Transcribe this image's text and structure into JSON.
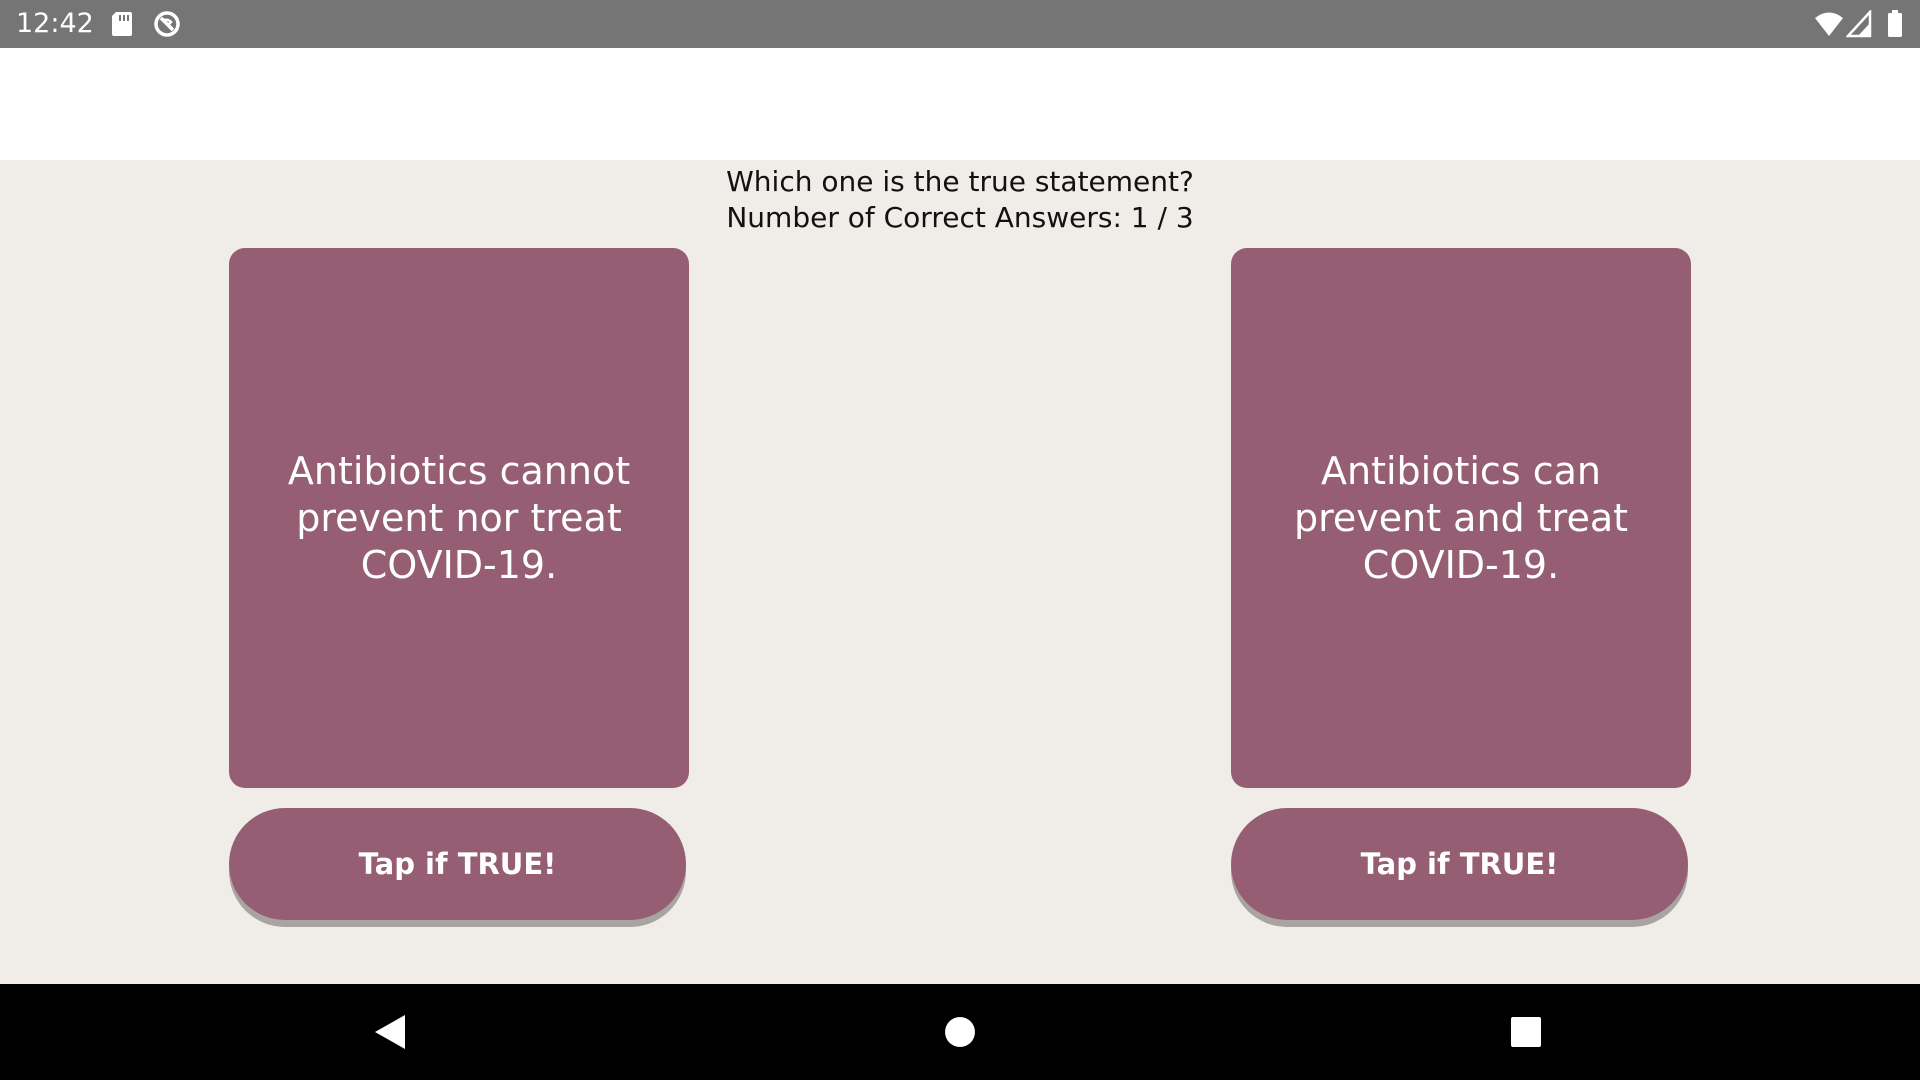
{
  "status_bar": {
    "time": "12:42",
    "icons": [
      "sd-card-icon",
      "sync-disabled-icon",
      "wifi-icon",
      "signal-icon",
      "battery-icon"
    ]
  },
  "quiz": {
    "question": "Which one is the true statement?",
    "score_text": "Number of Correct Answers: 1 / 3"
  },
  "cards": [
    {
      "statement": "Antibiotics cannot prevent nor treat COVID-19.",
      "button_label": "Tap if TRUE!"
    },
    {
      "statement": "Antibiotics can prevent and treat COVID-19.",
      "button_label": "Tap if TRUE!"
    }
  ],
  "nav_bar": {
    "icons": [
      "back-icon",
      "home-icon",
      "recents-icon"
    ]
  },
  "colors": {
    "status_bar": "#757575",
    "background": "#f0ede9",
    "card": "#955e73",
    "nav_bar": "#000000"
  }
}
